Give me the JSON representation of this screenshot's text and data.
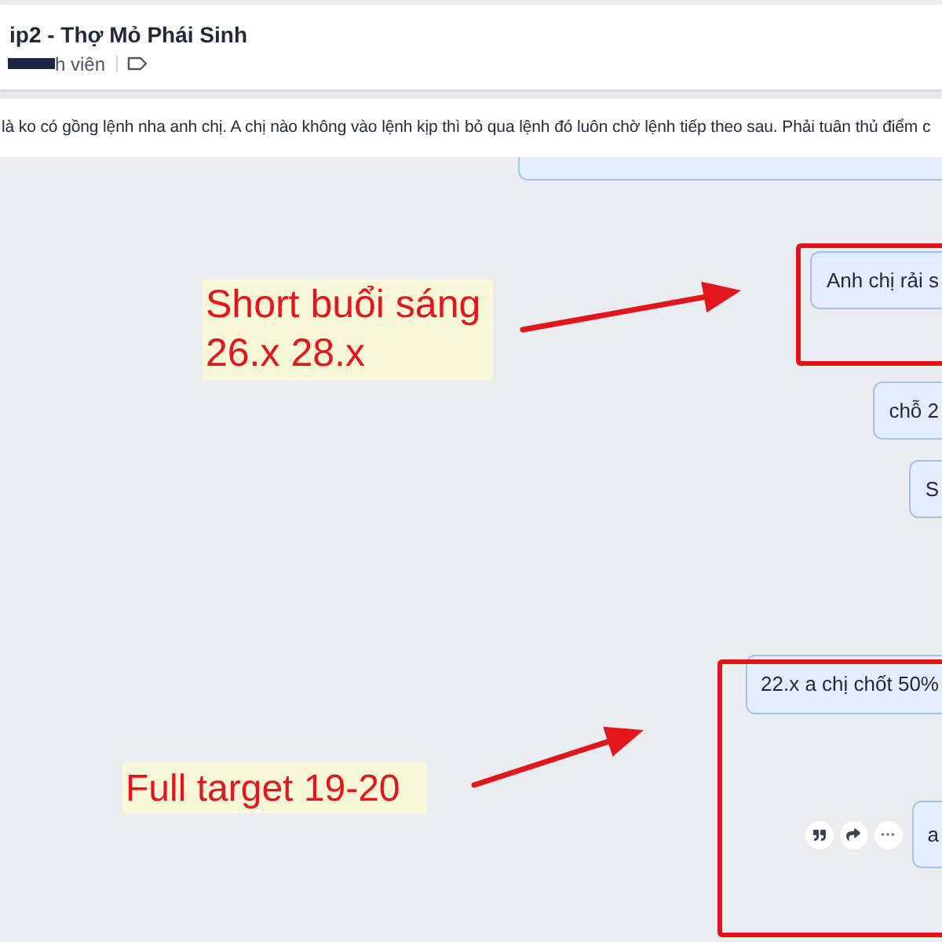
{
  "header": {
    "title": "ip2 - Thợ Mỏ Phái Sinh",
    "member_label": "h viên"
  },
  "pinned_message": "là ko có gồng lệnh nha anh chị. A chị nào không vào lệnh kịp thì bỏ qua lệnh đó luôn chờ lệnh tiếp theo sau. Phải tuân thủ điểm c",
  "messages": [
    {
      "kind": "covered"
    },
    {
      "kind": "text",
      "text": "Anh chị rải s"
    },
    {
      "kind": "text",
      "text": "chỗ 2"
    },
    {
      "kind": "text",
      "text": "S"
    },
    {
      "kind": "text",
      "text": "22.x a chị chốt 50%"
    },
    {
      "kind": "text",
      "text": "a",
      "hovered": true
    }
  ],
  "annotations": [
    {
      "lines": [
        "Short buổi sáng",
        "26.x 28.x"
      ]
    },
    {
      "lines": [
        "Full target 19-20"
      ]
    }
  ]
}
